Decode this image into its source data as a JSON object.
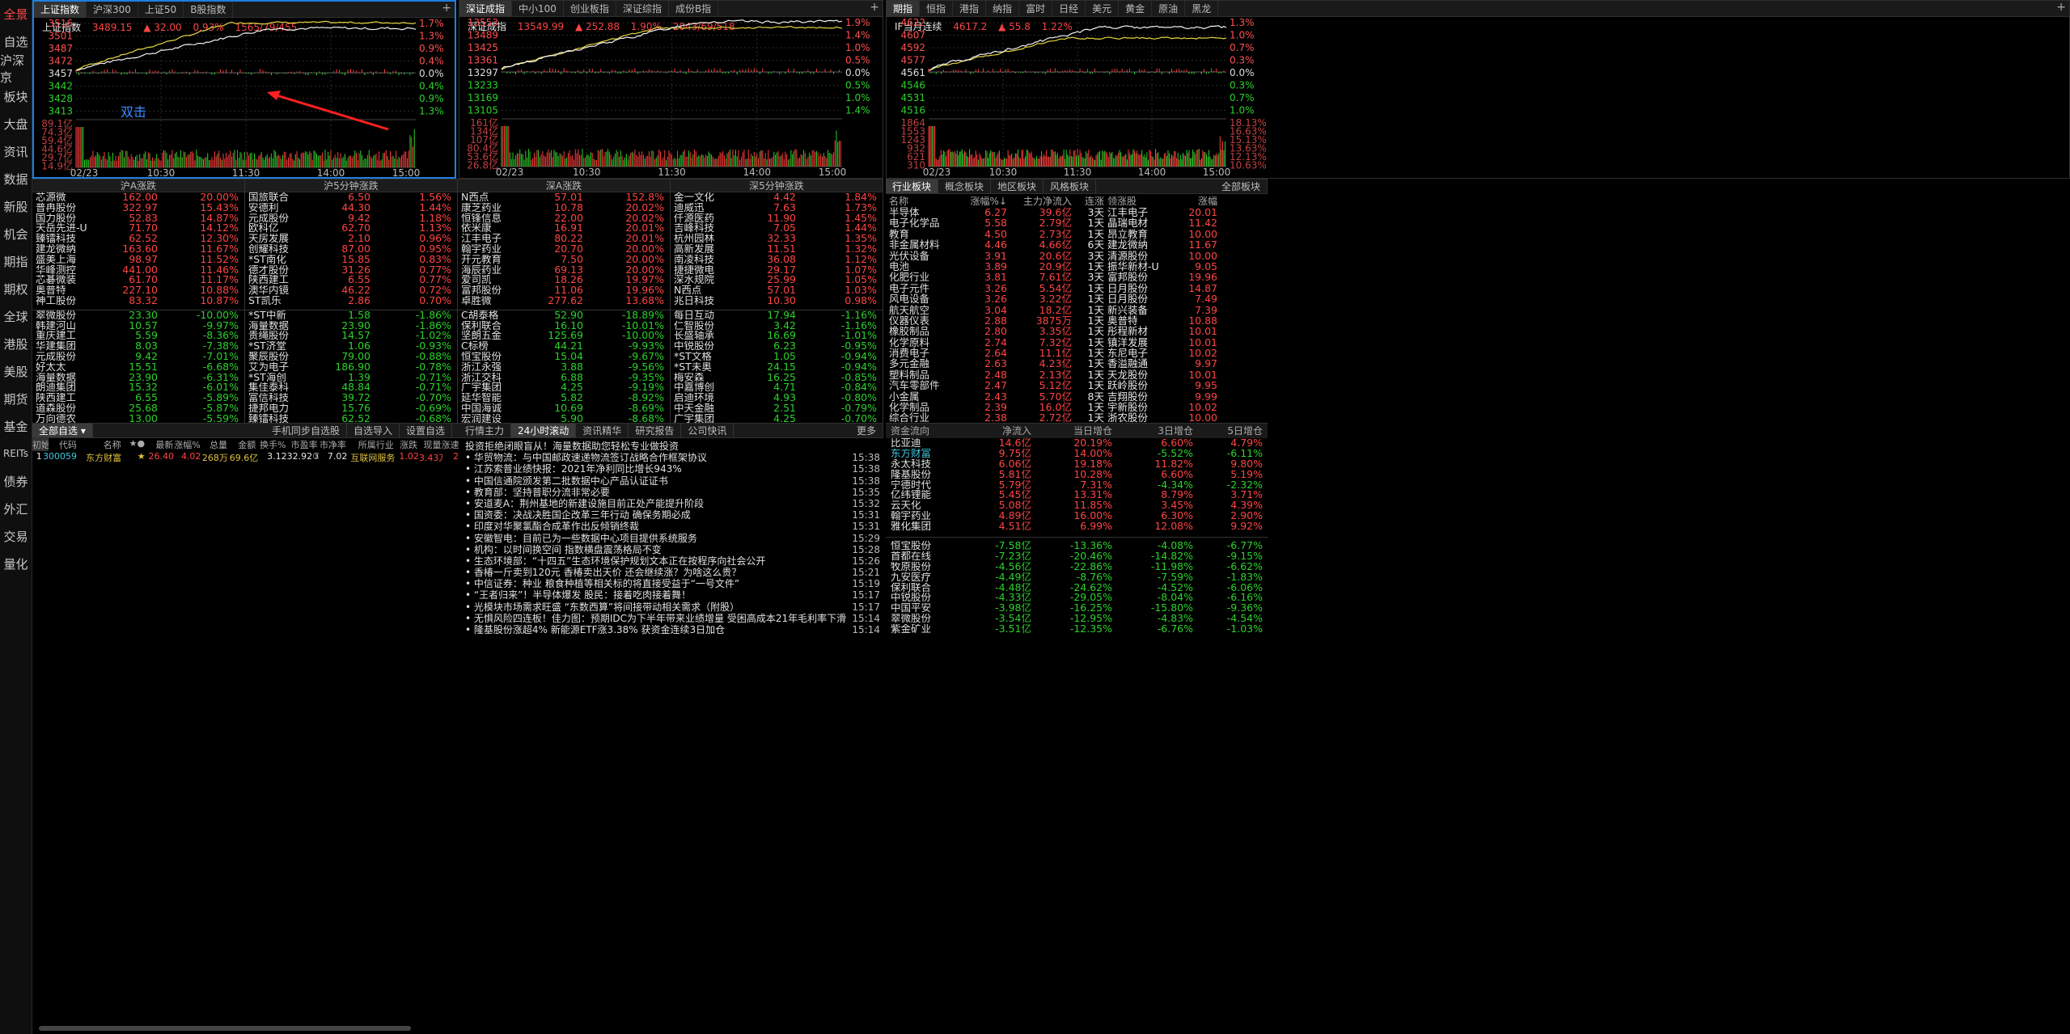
{
  "sidebar": [
    "全景",
    "自选",
    "沪深京",
    "板块",
    "大盘",
    "资讯",
    "数据",
    "新股",
    "机会",
    "期指",
    "期权",
    "全球",
    "港股",
    "美股",
    "期货",
    "基金",
    "REITs",
    "债券",
    "外汇",
    "交易",
    "量化"
  ],
  "panel1": {
    "tabs": [
      "上证指数",
      "沪深300",
      "上证50",
      "B股指数"
    ],
    "name": "上证指数",
    "price": "3489.15",
    "chg": "▲ 32.00",
    "pct": "0.93%",
    "breadth": "1565/79/455",
    "left_ticks": [
      "3516",
      "3501",
      "3487",
      "3472",
      "3457",
      "3442",
      "3428",
      "3413"
    ],
    "right_ticks": [
      "1.7%",
      "1.3%",
      "0.9%",
      "0.4%",
      "0.0%",
      "0.4%",
      "0.9%",
      "1.3%"
    ],
    "vol_ticks": [
      "89.1亿",
      "74.3亿",
      "59.4亿",
      "44.6亿",
      "29.7亿",
      "14.9亿"
    ],
    "vol_right": [
      "",
      "",
      "",
      "",
      "",
      ""
    ],
    "times": [
      "02/23",
      "10:30",
      "11:30",
      "14:00",
      "15:00"
    ],
    "annotation": "双击"
  },
  "panel2": {
    "tabs": [
      "深证成指",
      "中小100",
      "创业板指",
      "深证综指",
      "成份B指"
    ],
    "name": "深证成指",
    "price": "13549.99",
    "chg": "▲ 252.88",
    "pct": "1.90%",
    "breadth": "2043/69/518",
    "left_ticks": [
      "13553",
      "13489",
      "13425",
      "13361",
      "13297",
      "13233",
      "13169",
      "13105"
    ],
    "right_ticks": [
      "1.9%",
      "1.4%",
      "1.0%",
      "0.5%",
      "0.0%",
      "0.5%",
      "1.0%",
      "1.4%"
    ],
    "vol_ticks": [
      "161亿",
      "134亿",
      "107亿",
      "80.4亿",
      "53.6亿",
      "26.8亿"
    ],
    "times": [
      "02/23",
      "10:30",
      "11:30",
      "14:00",
      "15:00"
    ]
  },
  "panel3": {
    "tabs": [
      "期指",
      "恒指",
      "港指",
      "纳指",
      "富时",
      "日经",
      "美元",
      "黄金",
      "原油",
      "黑龙"
    ],
    "name": "IF当月连续",
    "price": "4617.2",
    "chg": "▲ 55.8",
    "pct": "1.22%",
    "left_ticks": [
      "4622",
      "4607",
      "4592",
      "4577",
      "4561",
      "4546",
      "4531",
      "4516"
    ],
    "right_ticks": [
      "1.3%",
      "1.0%",
      "0.7%",
      "0.3%",
      "0.0%",
      "0.3%",
      "0.7%",
      "1.0%"
    ],
    "vol_ticks": [
      "1864",
      "1553",
      "1243",
      "932",
      "621",
      "310"
    ],
    "vol_right": [
      "18.13%",
      "16.63%",
      "15.13%",
      "13.63%",
      "12.13%",
      "10.63%"
    ],
    "times": [
      "02/23",
      "10:30",
      "11:30",
      "14:00",
      "15:00"
    ]
  },
  "rank_heads": [
    "沪A涨跌",
    "沪5分钟涨跌",
    "深A涨跌",
    "深5分钟涨跌"
  ],
  "sh_up": [
    [
      "芯源微",
      "162.00",
      "20.00%"
    ],
    [
      "普冉股份",
      "322.97",
      "15.43%"
    ],
    [
      "国力股份",
      "52.83",
      "14.87%"
    ],
    [
      "天岳先进-U",
      "71.70",
      "14.12%"
    ],
    [
      "臻镭科技",
      "62.52",
      "12.30%"
    ],
    [
      "建龙微纳",
      "163.60",
      "11.67%"
    ],
    [
      "盛美上海",
      "98.97",
      "11.52%"
    ],
    [
      "华峰测控",
      "441.00",
      "11.46%"
    ],
    [
      "芯碁微装",
      "61.70",
      "11.17%"
    ],
    [
      "奥普特",
      "227.10",
      "10.88%"
    ],
    [
      "神工股份",
      "83.32",
      "10.87%"
    ]
  ],
  "sh_dn": [
    [
      "翠微股份",
      "23.30",
      "-10.00%"
    ],
    [
      "韩建河山",
      "10.57",
      "-9.97%"
    ],
    [
      "重庆建工",
      "5.59",
      "-8.36%"
    ],
    [
      "华建集团",
      "8.03",
      "-7.38%"
    ],
    [
      "元成股份",
      "9.42",
      "-7.01%"
    ],
    [
      "好太太",
      "15.51",
      "-6.68%"
    ],
    [
      "海量数据",
      "23.90",
      "-6.31%"
    ],
    [
      "朗迪集团",
      "15.32",
      "-6.01%"
    ],
    [
      "陕西建工",
      "6.55",
      "-5.89%"
    ],
    [
      "道森股份",
      "25.68",
      "-5.87%"
    ],
    [
      "万向德农",
      "13.00",
      "-5.59%"
    ]
  ],
  "sh5_up": [
    [
      "国旅联合",
      "6.50",
      "1.56%"
    ],
    [
      "安德利",
      "44.30",
      "1.44%"
    ],
    [
      "元成股份",
      "9.42",
      "1.18%"
    ],
    [
      "欧科亿",
      "62.70",
      "1.13%"
    ],
    [
      "天房发展",
      "2.10",
      "0.96%"
    ],
    [
      "创耀科技",
      "87.00",
      "0.95%"
    ],
    [
      "*ST南化",
      "15.85",
      "0.83%"
    ],
    [
      "德才股份",
      "31.26",
      "0.77%"
    ],
    [
      "陕西建工",
      "6.55",
      "0.77%"
    ],
    [
      "澳华内镜",
      "46.22",
      "0.72%"
    ],
    [
      "ST凯乐",
      "2.86",
      "0.70%"
    ]
  ],
  "sh5_dn": [
    [
      "*ST中新",
      "1.58",
      "-1.86%"
    ],
    [
      "海量数据",
      "23.90",
      "-1.86%"
    ],
    [
      "贵绳股份",
      "14.57",
      "-1.02%"
    ],
    [
      "*ST济堂",
      "1.06",
      "-0.93%"
    ],
    [
      "聚辰股份",
      "79.00",
      "-0.88%"
    ],
    [
      "艾为电子",
      "186.90",
      "-0.78%"
    ],
    [
      "*ST海创",
      "1.39",
      "-0.71%"
    ],
    [
      "集佳泰科",
      "48.84",
      "-0.71%"
    ],
    [
      "富信科技",
      "39.72",
      "-0.70%"
    ],
    [
      "捷邦电力",
      "15.76",
      "-0.69%"
    ],
    [
      "臻镭科技",
      "62.52",
      "-0.68%"
    ]
  ],
  "sz_up": [
    [
      "N西点",
      "57.01",
      "152.8%"
    ],
    [
      "康芝药业",
      "10.78",
      "20.02%"
    ],
    [
      "恒锋信息",
      "22.00",
      "20.02%"
    ],
    [
      "依米康",
      "16.91",
      "20.01%"
    ],
    [
      "江丰电子",
      "80.22",
      "20.01%"
    ],
    [
      "翰宇药业",
      "20.70",
      "20.00%"
    ],
    [
      "开元教育",
      "7.50",
      "20.00%"
    ],
    [
      "海辰药业",
      "69.13",
      "20.00%"
    ],
    [
      "爱司凯",
      "18.26",
      "19.97%"
    ],
    [
      "富邦股份",
      "11.06",
      "19.96%"
    ],
    [
      "卓胜微",
      "277.62",
      "13.68%"
    ]
  ],
  "sz_dn": [
    [
      "C胡泰格",
      "52.90",
      "-18.89%"
    ],
    [
      "保利联合",
      "16.10",
      "-10.01%"
    ],
    [
      "坚朗五金",
      "125.69",
      "-10.00%"
    ],
    [
      "C标榜",
      "44.21",
      "-9.93%"
    ],
    [
      "恒宝股份",
      "15.04",
      "-9.67%"
    ],
    [
      "浙江永强",
      "3.88",
      "-9.56%"
    ],
    [
      "浙江交科",
      "6.88",
      "-9.35%"
    ],
    [
      "广宇集团",
      "4.25",
      "-9.19%"
    ],
    [
      "延华智能",
      "5.82",
      "-8.92%"
    ],
    [
      "中国海诚",
      "10.69",
      "-8.69%"
    ],
    [
      "宏润建设",
      "5.90",
      "-8.68%"
    ]
  ],
  "sz5_up": [
    [
      "金一文化",
      "4.42",
      "1.84%"
    ],
    [
      "迪威迅",
      "7.63",
      "1.73%"
    ],
    [
      "仟源医药",
      "11.90",
      "1.45%"
    ],
    [
      "吉峰科技",
      "7.05",
      "1.44%"
    ],
    [
      "杭州园林",
      "32.33",
      "1.35%"
    ],
    [
      "高新发展",
      "11.51",
      "1.32%"
    ],
    [
      "南凌科技",
      "36.08",
      "1.12%"
    ],
    [
      "捷捷微电",
      "29.17",
      "1.07%"
    ],
    [
      "深水规院",
      "25.99",
      "1.05%"
    ],
    [
      "N西点",
      "57.01",
      "1.03%"
    ],
    [
      "兆日科技",
      "10.30",
      "0.98%"
    ]
  ],
  "sz5_dn": [
    [
      "每日互动",
      "17.94",
      "-1.16%"
    ],
    [
      "仁智股份",
      "3.42",
      "-1.16%"
    ],
    [
      "长盛轴承",
      "16.69",
      "-1.01%"
    ],
    [
      "中锐股份",
      "6.23",
      "-0.95%"
    ],
    [
      "*ST文格",
      "1.05",
      "-0.94%"
    ],
    [
      "*ST未奥",
      "24.15",
      "-0.94%"
    ],
    [
      "梅安森",
      "16.25",
      "-0.85%"
    ],
    [
      "中嘉博创",
      "4.71",
      "-0.84%"
    ],
    [
      "启迪环境",
      "4.93",
      "-0.80%"
    ],
    [
      "中天金融",
      "2.51",
      "-0.79%"
    ],
    [
      "广宇集团",
      "4.25",
      "-0.70%"
    ]
  ],
  "industry": {
    "tabs": [
      "行业板块",
      "概念板块",
      "地区板块",
      "风格板块"
    ],
    "right": "全部板块",
    "cols": [
      "名称",
      "涨幅%↓",
      "主力净流入",
      "连涨",
      "领涨股",
      "涨幅"
    ],
    "rows": [
      [
        "半导体",
        "6.27",
        "39.6亿",
        "3天",
        "江丰电子",
        "20.01"
      ],
      [
        "电子化学品",
        "5.58",
        "2.79亿",
        "1天",
        "晶瑞电材",
        "11.42"
      ],
      [
        "教育",
        "4.50",
        "2.73亿",
        "1天",
        "昂立教育",
        "10.00"
      ],
      [
        "非金属材料",
        "4.46",
        "4.66亿",
        "6天",
        "建龙微纳",
        "11.67"
      ],
      [
        "光伏设备",
        "3.91",
        "20.6亿",
        "3天",
        "清源股份",
        "10.00"
      ],
      [
        "电池",
        "3.89",
        "20.9亿",
        "1天",
        "振华新材-U",
        "9.05"
      ],
      [
        "化肥行业",
        "3.81",
        "7.61亿",
        "3天",
        "富邦股份",
        "19.96"
      ],
      [
        "电子元件",
        "3.26",
        "5.54亿",
        "1天",
        "日月股份",
        "14.87"
      ],
      [
        "风电设备",
        "3.26",
        "3.22亿",
        "1天",
        "日月股份",
        "7.49"
      ],
      [
        "航天航空",
        "3.04",
        "18.2亿",
        "1天",
        "新兴装备",
        "7.39"
      ],
      [
        "仪器仪表",
        "2.88",
        "3875万",
        "1天",
        "奥普特",
        "10.88"
      ],
      [
        "橡胶制品",
        "2.80",
        "3.35亿",
        "1天",
        "彤程新材",
        "10.01"
      ],
      [
        "化学原料",
        "2.74",
        "7.32亿",
        "1天",
        "镇洋发展",
        "10.01"
      ],
      [
        "消费电子",
        "2.64",
        "11.1亿",
        "1天",
        "东尼电子",
        "10.02"
      ],
      [
        "多元金融",
        "2.63",
        "4.23亿",
        "1天",
        "香溢融通",
        "9.97"
      ],
      [
        "塑料制品",
        "2.48",
        "2.13亿",
        "1天",
        "天龙股份",
        "10.01"
      ],
      [
        "汽车零部件",
        "2.47",
        "5.12亿",
        "1天",
        "跃岭股份",
        "9.95"
      ],
      [
        "小金属",
        "2.43",
        "5.70亿",
        "8天",
        "吉翔股份",
        "9.99"
      ],
      [
        "化学制品",
        "2.39",
        "16.0亿",
        "1天",
        "宇新股份",
        "10.02"
      ],
      [
        "综合行业",
        "2.38",
        "2.72亿",
        "1天",
        "浙农股份",
        "10.00"
      ]
    ]
  },
  "watch": {
    "dropdown": "全部自选",
    "links": [
      "手机同步自选股",
      "自选导入",
      "设置自选"
    ],
    "sort_tab": "初始",
    "cols": [
      "代码",
      "名称",
      "★●",
      "最新",
      "涨幅%",
      "总量",
      "金额",
      "换手%",
      "市盈率",
      "市净率",
      "所属行业",
      "涨跌",
      "现量",
      "涨速"
    ],
    "rows": [
      [
        "1",
        "300059",
        "东方财富",
        "★",
        "26.40",
        "4.02",
        "268万",
        "69.6亿",
        "3.12",
        "32.92③",
        "7.02",
        "互联网服务",
        "1.02",
        "3.43万",
        "2"
      ]
    ]
  },
  "newsbox": {
    "tabs": [
      "行情主力",
      "24小时滚动",
      "资讯精华",
      "研究报告",
      "公司快讯"
    ],
    "more": "更多",
    "items": [
      [
        "投资拒绝闭眼盲从！海量数据助您轻松专业做投资",
        ""
      ],
      [
        "华贸物流：与中国邮政速递物流签订战略合作框架协议",
        "15:38"
      ],
      [
        "江苏索普业绩快报：2021年净利同比增长943%",
        "15:38"
      ],
      [
        "中国信通院颁发第二批数据中心产品认证证书",
        "15:38"
      ],
      [
        "教育部：坚持普职分流非常必要",
        "15:35"
      ],
      [
        "安道麦A：荆州基地的新建设施目前正处产能提升阶段",
        "15:32"
      ],
      [
        "国资委：决战决胜国企改革三年行动 确保务期必成",
        "15:31"
      ],
      [
        "印度对华聚氯酯合成革作出反倾销终裁",
        "15:31"
      ],
      [
        "安徽智电：目前已为一些数据中心项目提供系统服务",
        "15:29"
      ],
      [
        "机构：以时间换空间 指数横盘震荡格局不变",
        "15:28"
      ],
      [
        "生态环境部：“十四五”生态环境保护规划文本正在按程序向社会公开",
        "15:26"
      ],
      [
        "香椿一斤卖到120元 香椿卖出天价 还会继续涨？为啥这么贵？",
        "15:21"
      ],
      [
        "中信证券：种业 粮食种植等相关标的将直接受益于“一号文件”",
        "15:19"
      ],
      [
        "“王者归来”！半导体爆发 股民：接着吃肉接着舞！",
        "15:17"
      ],
      [
        "光模块市场需求旺盛 “东数西算”将间接带动相关需求（附股）",
        "15:17"
      ],
      [
        "无惧风险四连板！佳力图：预期IDC为下半年带来业绩增量 受困高成本21年毛利率下滑",
        "15:14"
      ],
      [
        "隆基股份涨超4% 新能源ETF涨3.38% 获资金连续3日加仓",
        "15:14"
      ]
    ]
  },
  "funds": {
    "cols": [
      "资金流向",
      "净流入",
      "当日增仓",
      "3日增仓",
      "5日增仓"
    ],
    "in": [
      [
        "比亚迪",
        "14.6亿",
        "20.19%",
        "6.60%",
        "4.79%"
      ],
      [
        "东方财富",
        "9.75亿",
        "14.00%",
        "-5.52%",
        "-6.11%"
      ],
      [
        "永太科技",
        "6.06亿",
        "19.18%",
        "11.82%",
        "9.80%"
      ],
      [
        "隆基股份",
        "5.81亿",
        "10.28%",
        "6.60%",
        "5.19%"
      ],
      [
        "宁德时代",
        "5.79亿",
        "7.31%",
        "-4.34%",
        "-2.32%"
      ],
      [
        "亿纬锂能",
        "5.45亿",
        "13.31%",
        "8.79%",
        "3.71%"
      ],
      [
        "云天化",
        "5.08亿",
        "11.85%",
        "3.45%",
        "4.39%"
      ],
      [
        "翰宇药业",
        "4.89亿",
        "16.00%",
        "6.30%",
        "2.90%"
      ],
      [
        "雅化集团",
        "4.51亿",
        "6.99%",
        "12.08%",
        "9.92%"
      ]
    ],
    "out": [
      [
        "恒宝股份",
        "-7.58亿",
        "-13.36%",
        "-4.08%",
        "-6.77%"
      ],
      [
        "首都在线",
        "-7.23亿",
        "-20.46%",
        "-14.82%",
        "-9.15%"
      ],
      [
        "牧原股份",
        "-4.56亿",
        "-22.86%",
        "-11.98%",
        "-6.62%"
      ],
      [
        "九安医疗",
        "-4.49亿",
        "-8.76%",
        "-7.59%",
        "-1.83%"
      ],
      [
        "保利联合",
        "-4.48亿",
        "-24.62%",
        "-4.52%",
        "-6.06%"
      ],
      [
        "中锐股份",
        "-4.33亿",
        "-29.05%",
        "-8.04%",
        "-6.16%"
      ],
      [
        "中国平安",
        "-3.98亿",
        "-16.25%",
        "-15.80%",
        "-9.36%"
      ],
      [
        "翠微股份",
        "-3.54亿",
        "-12.95%",
        "-4.83%",
        "-4.54%"
      ],
      [
        "紫金矿业",
        "-3.51亿",
        "-12.35%",
        "-6.76%",
        "-1.03%"
      ]
    ]
  }
}
